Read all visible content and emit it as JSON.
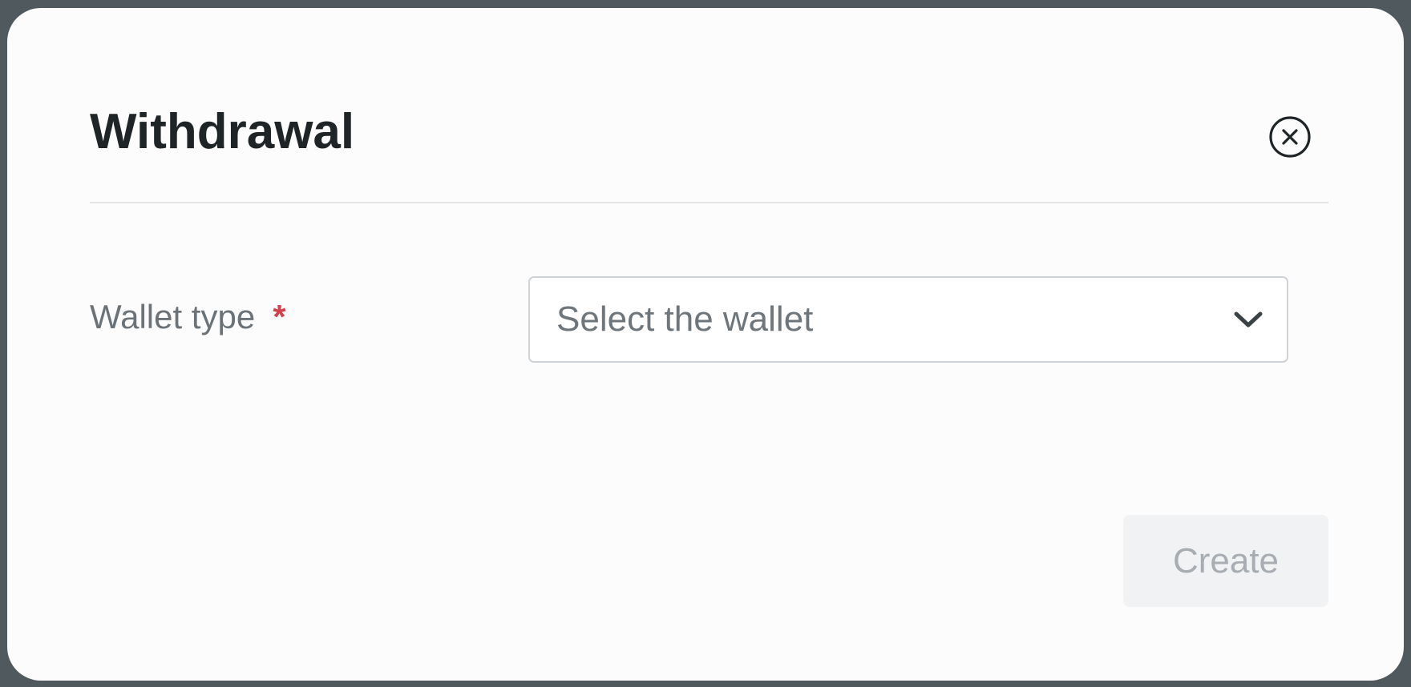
{
  "dialog": {
    "title": "Withdrawal",
    "close_icon": "close-circle-icon"
  },
  "form": {
    "wallet_type": {
      "label": "Wallet type",
      "required_mark": "*",
      "placeholder": "Select the wallet",
      "icon": "chevron-down-icon"
    }
  },
  "footer": {
    "create_label": "Create",
    "create_disabled": true
  },
  "colors": {
    "backdrop": "#4f595e",
    "modal_bg": "#fcfcfc",
    "title": "#1f2427",
    "required": "#d4404a",
    "disabled_button_bg": "#f1f2f3",
    "disabled_button_text": "#a7adb2"
  }
}
